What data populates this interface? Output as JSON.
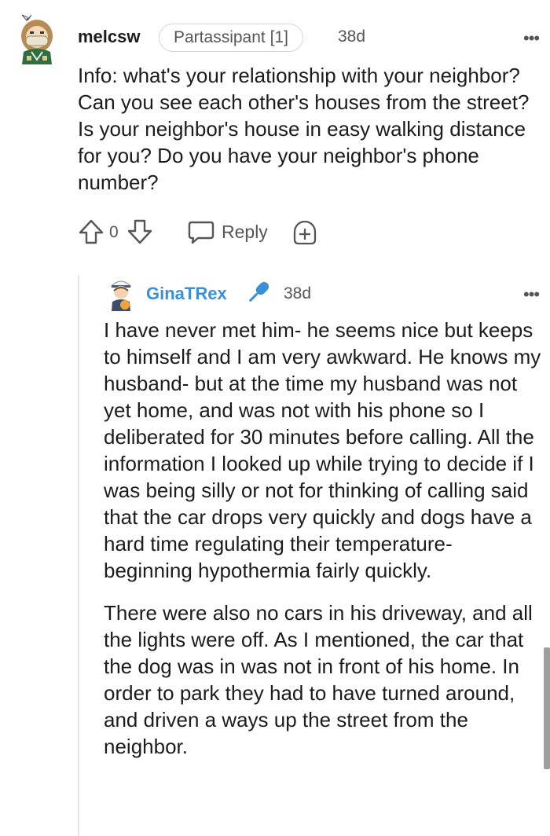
{
  "top_comment": {
    "username": "melcsw",
    "flair": "Partassipant [1]",
    "time": "38d",
    "more": "•••",
    "body": "Info: what's your relationship with your neighbor? Can you see each other's houses from the street? Is your neighbor's house in easy walking distance for you? Do you have your neighbor's phone number?",
    "vote_count": "0",
    "reply_label": "Reply",
    "icons": [
      "upvote-icon",
      "downvote-icon",
      "reply-icon",
      "award-icon",
      "more-icon"
    ]
  },
  "reply_comment": {
    "username": "GinaTRex",
    "time": "38d",
    "more": "•••",
    "paragraphs": [
      "I have never met him- he seems nice but keeps to himself and I am very awkward. He knows my husband- but at the time my husband was not yet home, and was not with his phone so I deliberated for 30 minutes before calling. All the information I looked up while trying to decide if I was being silly or not for thinking of calling said that the car drops very quickly and dogs have a hard time regulating their temperature- beginning hypothermia fairly quickly.",
      "There were also no cars in his driveway, and all the lights were off. As I mentioned, the car that the dog was in was not in front of his home. In order to park they had to have turned around, and driven a ways up the street from the neighbor."
    ],
    "colors": {
      "username": "#3a8fd8",
      "mic": "#3a8fd8"
    }
  }
}
